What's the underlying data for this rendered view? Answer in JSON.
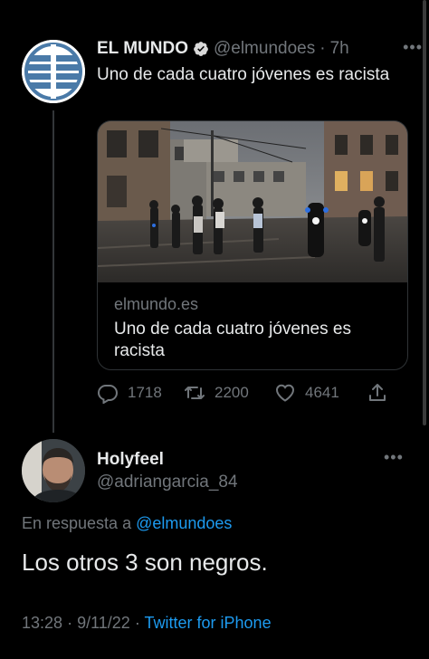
{
  "tweet": {
    "author_name": "EL MUNDO",
    "author_handle": "@elmundoes",
    "separator": "·",
    "time_ago": "7h",
    "text": "Uno de cada cuatro jóvenes es racista",
    "avatar_icon": "el-mundo-logo",
    "card": {
      "domain": "elmundo.es",
      "title": "Uno de cada cuatro jóvenes es racista"
    },
    "actions": {
      "replies": "1718",
      "retweets": "2200",
      "likes": "4641"
    }
  },
  "reply": {
    "author_name": "Holyfeel",
    "author_handle": "@adriangarcia_84",
    "reply_prefix": "En respuesta a",
    "reply_mention": "@elmundoes",
    "text": "Los otros 3 son negros.",
    "time": "13:28",
    "date": "9/11/22",
    "separator": "·",
    "source": "Twitter for iPhone"
  },
  "colors": {
    "background": "#000000",
    "text": "#e7e9ea",
    "secondary": "#71767b",
    "accent": "#1d9bf0",
    "border": "#2f3336"
  }
}
